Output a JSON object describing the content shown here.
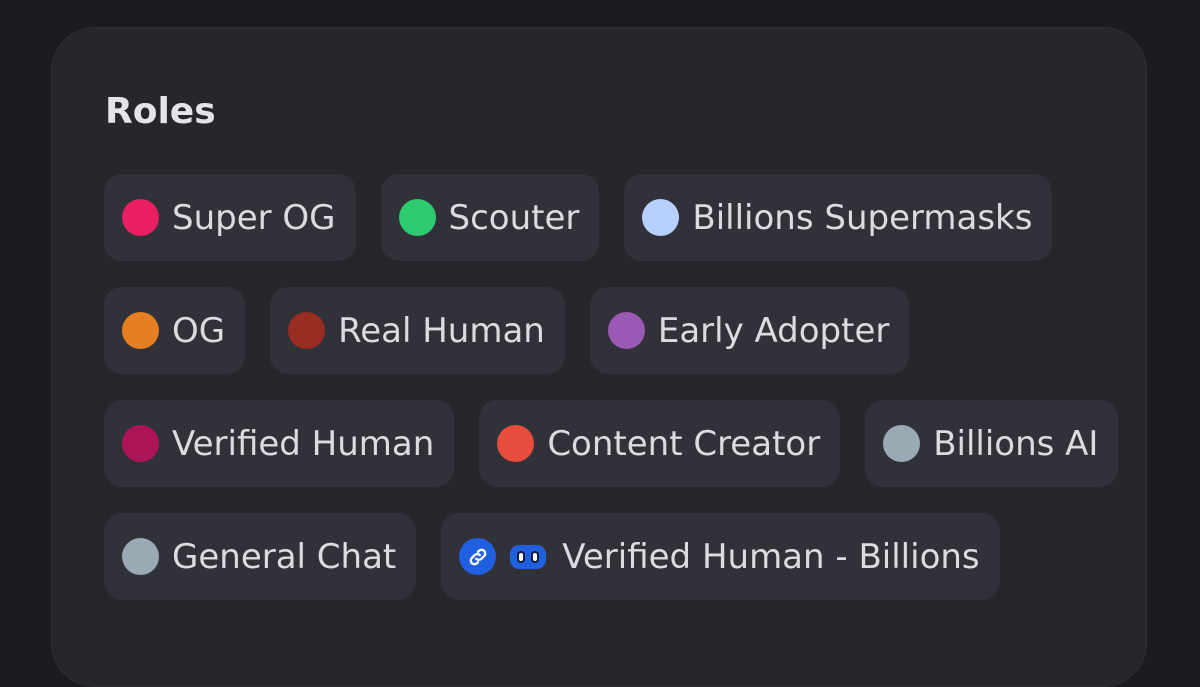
{
  "title": "Roles",
  "roles": [
    {
      "label": "Super OG",
      "color": "#e91e63"
    },
    {
      "label": "Scouter",
      "color": "#2ecc71"
    },
    {
      "label": "Billions Supermasks",
      "color": "#b7d0ff"
    },
    {
      "label": "OG",
      "color": "#e67e22"
    },
    {
      "label": "Real Human",
      "color": "#992d22"
    },
    {
      "label": "Early Adopter",
      "color": "#9b59b6"
    },
    {
      "label": "Verified Human",
      "color": "#ad1457"
    },
    {
      "label": "Content Creator",
      "color": "#e74c3c"
    },
    {
      "label": "Billions AI",
      "color": "#99aab5"
    },
    {
      "label": "General Chat",
      "color": "#99aab5"
    },
    {
      "label": "Verified Human - Billions",
      "icons": [
        "link-icon",
        "mask-icon"
      ],
      "icon_color": "#1f5fe0"
    }
  ]
}
